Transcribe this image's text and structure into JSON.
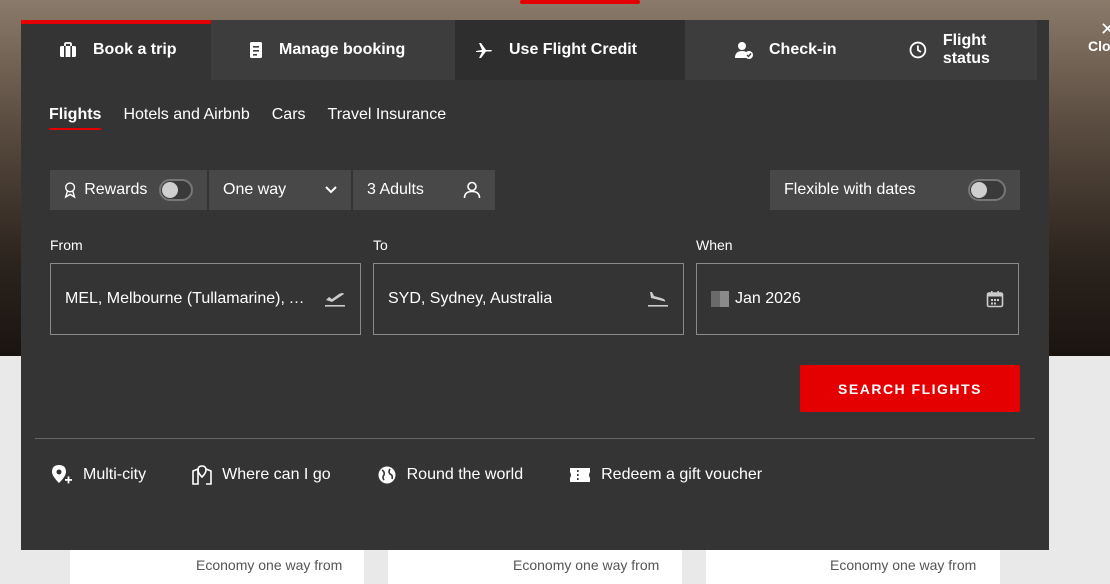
{
  "main_tabs": [
    {
      "label": "Book a trip",
      "icon": "suitcase-icon"
    },
    {
      "label": "Manage booking",
      "icon": "booking-icon"
    },
    {
      "label": "Use Flight Credit",
      "icon": "plane-icon"
    },
    {
      "label": "Check-in",
      "icon": "checkin-icon"
    },
    {
      "label": "Flight status",
      "icon": "clock-icon"
    }
  ],
  "close_label": "Clo",
  "sub_tabs": [
    "Flights",
    "Hotels and Airbnb",
    "Cars",
    "Travel Insurance"
  ],
  "options": {
    "rewards_label": "Rewards",
    "trip_type": "One way",
    "passengers": "3 Adults",
    "flexible_label": "Flexible with dates"
  },
  "fields": {
    "from_label": "From",
    "from_value": "MEL, Melbourne (Tullamarine), Australia",
    "to_label": "To",
    "to_value": "SYD, Sydney, Australia",
    "when_label": "When",
    "when_value": "Jan 2026"
  },
  "search_button": "SEARCH FLIGHTS",
  "quick_links": [
    "Multi-city",
    "Where can I go",
    "Round the world",
    "Redeem a gift voucher"
  ],
  "deals": [
    "Economy one way from",
    "Economy one way from",
    "Economy one way from"
  ],
  "colors": {
    "accent": "#e40000",
    "panel": "#343434"
  }
}
